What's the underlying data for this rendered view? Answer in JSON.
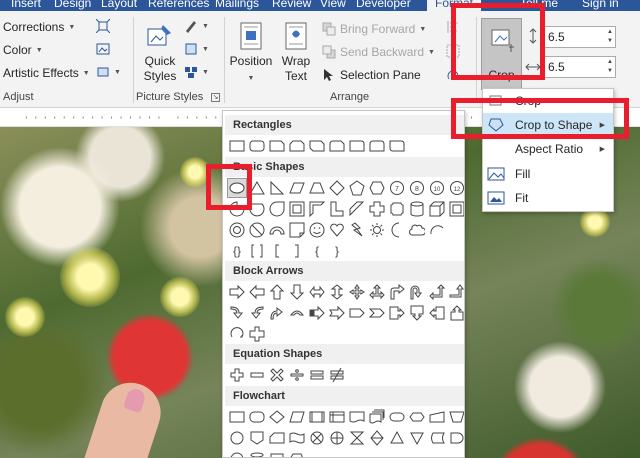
{
  "tabs": [
    "Insert",
    "Design",
    "Layout",
    "References",
    "Mailings",
    "Review",
    "View",
    "Developer",
    "Format",
    "Tell me",
    "Sign in"
  ],
  "adjust": {
    "corrections": "Corrections",
    "color": "Color",
    "artistic_effects": "Artistic Effects",
    "group_label": "Adjust"
  },
  "picture_styles": {
    "quick_styles_line1": "Quick",
    "quick_styles_line2": "Styles",
    "group_label": "Picture Styles"
  },
  "arrange": {
    "position": "Position",
    "wrap_line1": "Wrap",
    "wrap_line2": "Text",
    "bring_forward": "Bring Forward",
    "send_backward": "Send Backward",
    "selection_pane": "Selection Pane",
    "group_label": "Arrange"
  },
  "size": {
    "crop": "Crop",
    "height_value": "6.5",
    "width_value": "6.5"
  },
  "shapes_panel": {
    "categories": [
      "Rectangles",
      "Basic Shapes",
      "Block Arrows",
      "Equation Shapes",
      "Flowchart"
    ],
    "selected_shape": "oval"
  },
  "crop_menu": {
    "items": [
      {
        "label": "Crop",
        "icon": "crop-icon"
      },
      {
        "label": "Crop to Shape",
        "icon": "crop-to-shape-icon",
        "has_submenu": true
      },
      {
        "label": "Aspect Ratio",
        "icon": "",
        "has_submenu": true
      },
      {
        "label": "Fill",
        "icon": "fill-icon"
      },
      {
        "label": "Fit",
        "icon": "fit-icon"
      }
    ]
  },
  "colors": {
    "tab_bar": "#2b579a",
    "ribbon": "#f3f3f3",
    "annotation_red": "#ea1d2c",
    "menu_highlight": "#cde6f7"
  }
}
